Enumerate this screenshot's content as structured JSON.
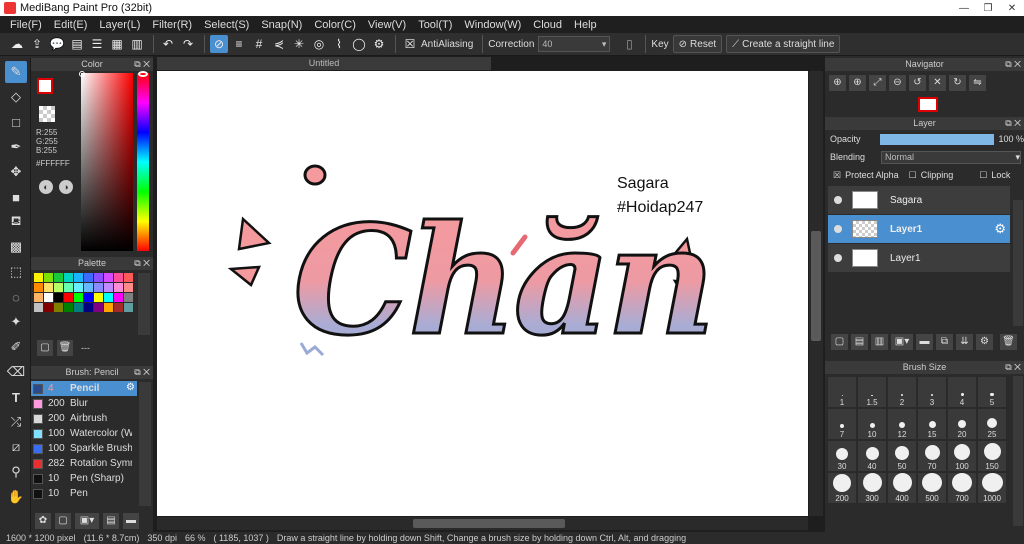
{
  "window": {
    "title": "MediBang Paint Pro (32bit)"
  },
  "menu": [
    "File(F)",
    "Edit(E)",
    "Layer(L)",
    "Filter(R)",
    "Select(S)",
    "Snap(N)",
    "Color(C)",
    "View(V)",
    "Tool(T)",
    "Window(W)",
    "Cloud",
    "Help"
  ],
  "toolbar": {
    "antialiasing_label": "AntiAliasing",
    "correction_label": "Correction",
    "correction_value": "40",
    "key_label": "Key",
    "reset_label": "Reset",
    "straight_line_label": "Create a straight line"
  },
  "color_panel": {
    "title": "Color",
    "r": "R:255",
    "g": "G:255",
    "b": "B:255",
    "hex": "#FFFFFF"
  },
  "palette_panel": {
    "title": "Palette",
    "footer": "---",
    "swatches": [
      "#fff200",
      "#7ee000",
      "#17c93b",
      "#00d2c0",
      "#1ab4ff",
      "#3e6bff",
      "#8a4dff",
      "#d64bff",
      "#ff4f9a",
      "#ff5a5a",
      "#ff8a00",
      "#ffe066",
      "#b8ff66",
      "#66ffb0",
      "#66f0ff",
      "#66b8ff",
      "#8a8aff",
      "#c28aff",
      "#ff8ad6",
      "#ff8a8a",
      "#ffb366",
      "#ffffff",
      "#000000",
      "#ff0000",
      "#00ff00",
      "#0000ff",
      "#ffff00",
      "#00ffff",
      "#ff00ff",
      "#808080",
      "#c0c0c0",
      "#800000",
      "#808000",
      "#008000",
      "#008080",
      "#000080",
      "#800080",
      "#ffa500",
      "#a52a2a",
      "#5f9ea0"
    ]
  },
  "brush_panel": {
    "title": "Brush: Pencil",
    "brushes": [
      {
        "size": "4",
        "name": "Pencil",
        "color": "#2a4a8a",
        "selected": true
      },
      {
        "size": "200",
        "name": "Blur",
        "color": "#ff9bdc",
        "selected": false
      },
      {
        "size": "200",
        "name": "Airbrush",
        "color": "#d8d8d8",
        "selected": false
      },
      {
        "size": "100",
        "name": "Watercolor (We",
        "color": "#7fe0ff",
        "selected": false
      },
      {
        "size": "100",
        "name": "Sparkle Brush",
        "color": "#3a6cf0",
        "selected": false
      },
      {
        "size": "282",
        "name": "Rotation Symme",
        "color": "#e83030",
        "selected": false
      },
      {
        "size": "10",
        "name": "Pen (Sharp)",
        "color": "#111111",
        "selected": false
      },
      {
        "size": "10",
        "name": "Pen",
        "color": "#111111",
        "selected": false
      }
    ]
  },
  "document": {
    "tab_title": "Untitled",
    "text_line1": "Sagara",
    "text_line2": "#Hoidap247",
    "art_text": "Chăn"
  },
  "navigator": {
    "title": "Navigator"
  },
  "layer_panel": {
    "title": "Layer",
    "opacity_label": "Opacity",
    "opacity_value": "100 %",
    "opacity_fraction": 1.0,
    "blending_label": "Blending",
    "blending_value": "Normal",
    "protect_alpha": "Protect Alpha",
    "clipping": "Clipping",
    "lock": "Lock",
    "layers": [
      {
        "name": "Sagara",
        "selected": false
      },
      {
        "name": "Layer1",
        "selected": true
      },
      {
        "name": "Layer1",
        "selected": false
      }
    ]
  },
  "brush_size_panel": {
    "title": "Brush Size",
    "sizes": [
      "1",
      "1.5",
      "2",
      "3",
      "4",
      "5",
      "7",
      "10",
      "12",
      "15",
      "20",
      "25",
      "30",
      "40",
      "50",
      "70",
      "100",
      "150",
      "200",
      "300",
      "400",
      "500",
      "700",
      "1000"
    ]
  },
  "status": {
    "size": "1600 * 1200 pixel",
    "physical": "(11.6 * 8.7cm)",
    "dpi": "350 dpi",
    "zoom": "66 %",
    "coords": "( 1185, 1037 )",
    "hint": "Draw a straight line by holding down Shift, Change a brush size by holding down Ctrl, Alt, and dragging"
  }
}
